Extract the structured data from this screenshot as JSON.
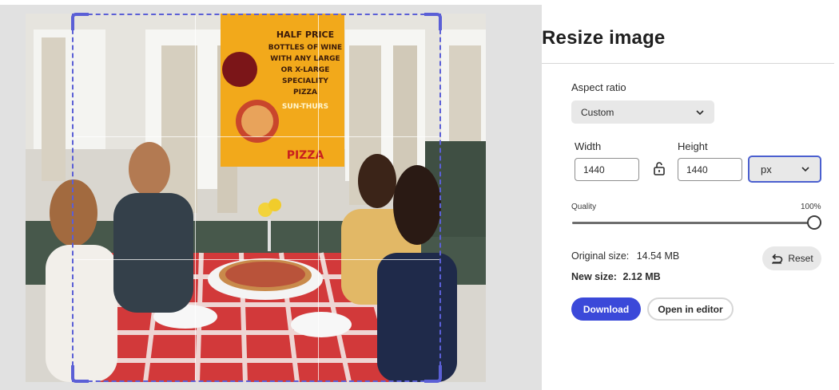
{
  "panel": {
    "title": "Resize image"
  },
  "aspect_ratio": {
    "label": "Aspect ratio",
    "selected": "Custom"
  },
  "dimensions": {
    "width_label": "Width",
    "width_value": "1440",
    "height_label": "Height",
    "height_value": "1440",
    "unit": "px",
    "lock_icon": "unlocked-padlock-icon"
  },
  "quality": {
    "label": "Quality",
    "value_label": "100%",
    "value": 1.0
  },
  "sizes": {
    "original_label": "Original size:",
    "original_value": "14.54 MB",
    "new_label": "New size:",
    "new_value": "2.12 MB"
  },
  "actions": {
    "reset_label": "Reset",
    "reset_icon": "undo-arrow-icon",
    "download_label": "Download",
    "open_editor_label": "Open in editor"
  },
  "photo": {
    "poster_lines": [
      "HALF PRICE",
      "BOTTLES OF WINE",
      "WITH ANY LARGE",
      "OR X-LARGE",
      "SPECIALITY",
      "PIZZA",
      "SUN-THURS"
    ],
    "poster_brand": "PIZZA"
  },
  "colors": {
    "accent": "#3b49d9",
    "crop_frame": "#5b5fd6",
    "unit_border": "#4b5fcf"
  }
}
